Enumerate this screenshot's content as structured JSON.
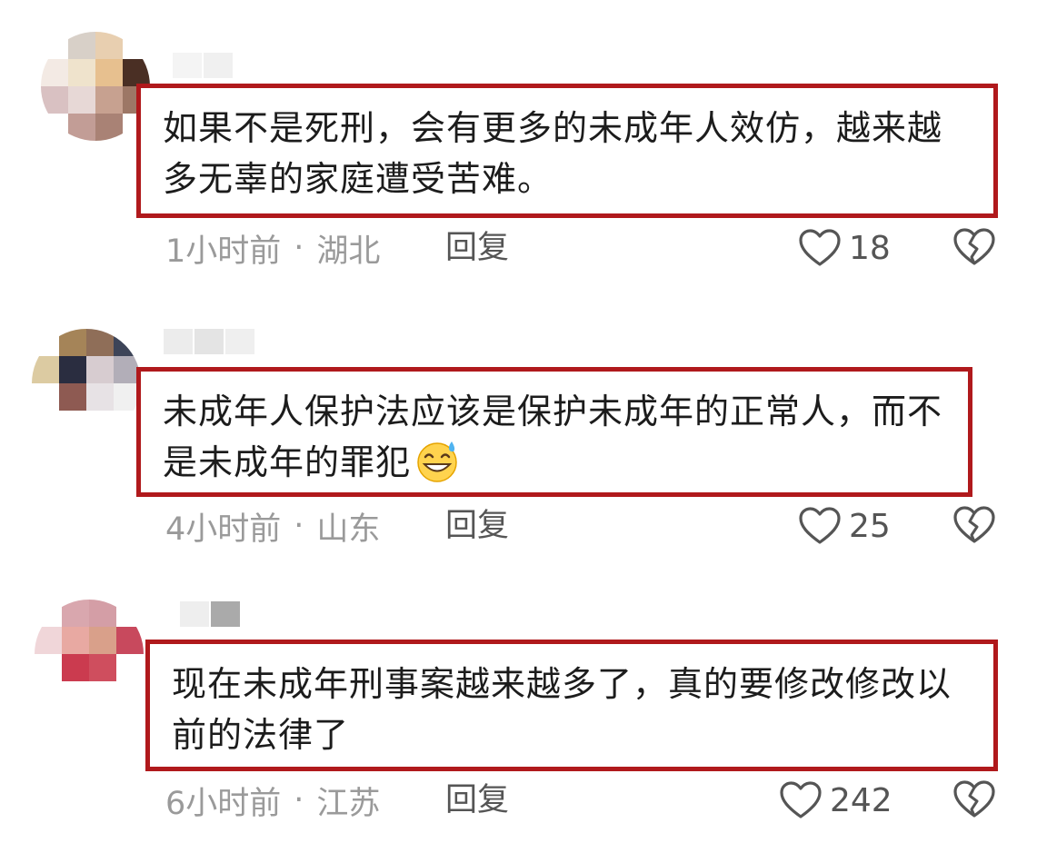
{
  "comments": [
    {
      "text": "如果不是死刑，会有更多的未成年人效仿，越来越多无辜的家庭遭受苦难。",
      "time": "1小时前",
      "separator": "·",
      "location": "湖北",
      "reply_label": "回复",
      "likes": "18",
      "has_emoji": false,
      "avatar_colors": [
        "#ffffff",
        "#d8d0c8",
        "#e8cfb0",
        "#ffffff",
        "#f3eae4",
        "#efe3cc",
        "#e7c08f",
        "#4a2f24",
        "#d9c1c2",
        "#e7d8d6",
        "#c7a190",
        "#9d7766",
        "#ffffff",
        "#c29d96",
        "#a98275",
        "#ffffff"
      ],
      "name_colors": [
        "#f4f4f4",
        "#f0f0f0"
      ]
    },
    {
      "text": "未成年人保护法应该是保护未成年的正常人，而不是未成年的罪犯",
      "time": "4小时前",
      "separator": "·",
      "location": "山东",
      "reply_label": "回复",
      "likes": "25",
      "has_emoji": true,
      "emoji_name": "grinning-sweat-emoji",
      "avatar_colors": [
        "#ffffff",
        "#a58458",
        "#8f6e58",
        "#3d4458",
        "#dccba2",
        "#2a2d40",
        "#d7ccd0",
        "#b2aeb8",
        "#ffffff",
        "#8e5a52",
        "#e7e2e5",
        "#f0f0f0",
        "#ffffff",
        "#ffffff",
        "#ffffff",
        "#ffffff"
      ],
      "name_colors": [
        "#ececec",
        "#e4e4e4",
        "#efefef"
      ]
    },
    {
      "text": "现在未成年刑事案越来越多了，真的要修改修改以前的法律了",
      "time": "6小时前",
      "separator": "·",
      "location": "江苏",
      "reply_label": "回复",
      "likes": "242",
      "has_emoji": false,
      "avatar_colors": [
        "#ffffff",
        "#d9a7ae",
        "#d49ea6",
        "#ffffff",
        "#f0d6d9",
        "#e8a9a2",
        "#d9a08a",
        "#c8495d",
        "#ffffff",
        "#cb3b4f",
        "#cf4e5e",
        "#ffffff",
        "#ffffff",
        "#ffffff",
        "#ffffff",
        "#ffffff"
      ],
      "name_colors": [
        "#eeeeee",
        "#aaaaaa"
      ]
    }
  ],
  "colors": {
    "highlight_border": "#b0191c",
    "meta_text": "#9a9a9a",
    "action_text": "#555555"
  }
}
